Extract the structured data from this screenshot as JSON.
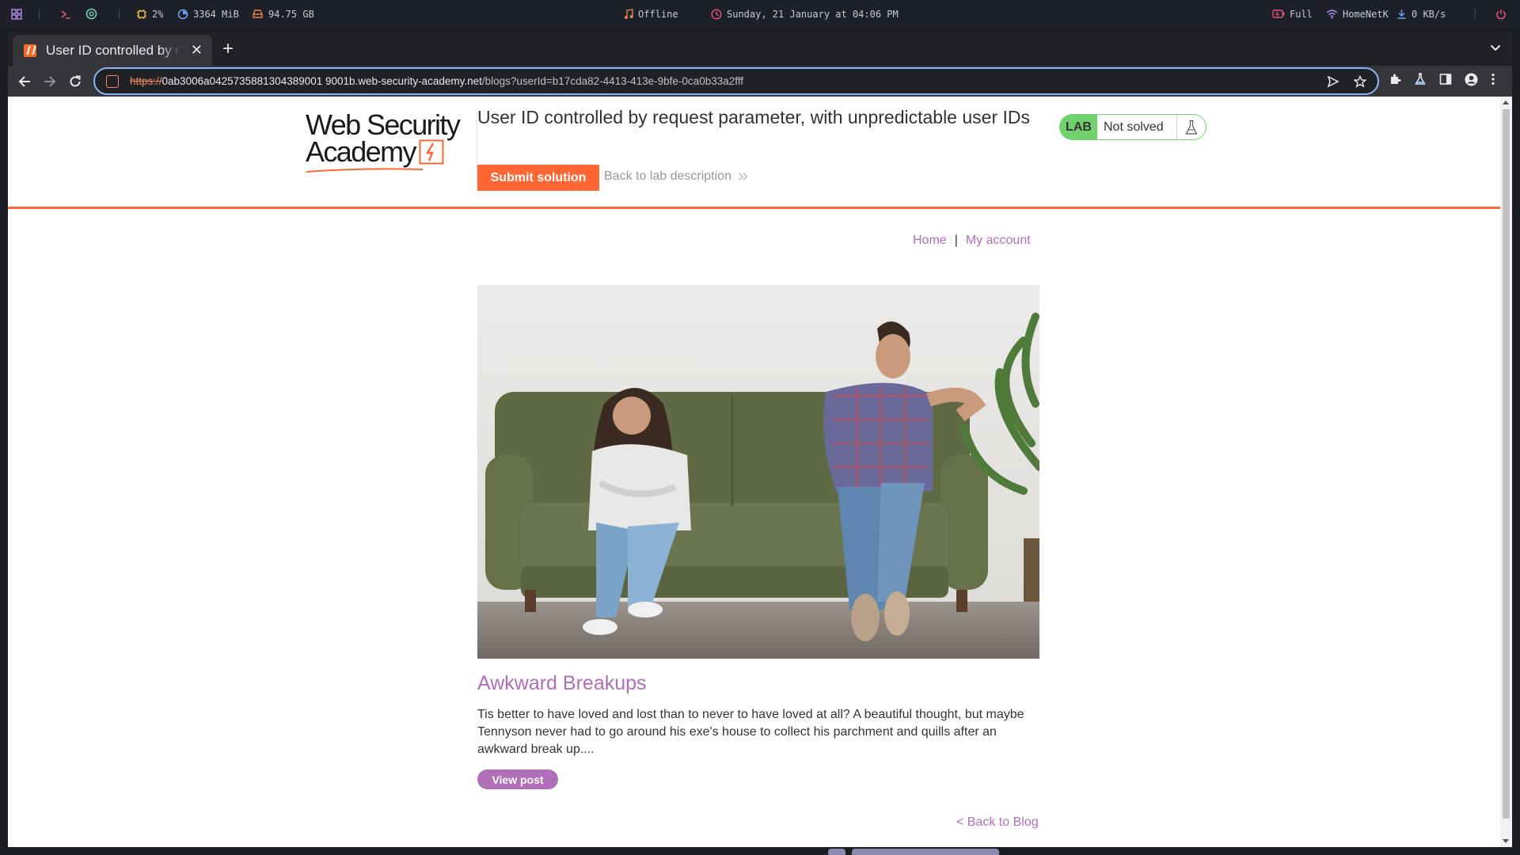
{
  "sysbar": {
    "cpu": "2%",
    "memory": "3364 MiB",
    "disk": "94.75 GB",
    "music": "Offline",
    "datetime": "Sunday, 21 January at 04:06 PM",
    "battery": "Full",
    "wifi": "HomeNetK",
    "net_speed": "0 KB/s"
  },
  "browser": {
    "tab_title": "User ID controlled by request parameter, with unpredictable user IDs",
    "url_scheme": "https://",
    "url_host": "0ab3006a0425735881304389001 9001b.web-security-academy.net",
    "url_path": "/blogs?userId=b17cda82-4413-413e-9bfe-0ca0b33a2fff"
  },
  "lab": {
    "logo_line1": "Web Security",
    "logo_line2": "Academy",
    "title": "User ID controlled by request parameter, with unpredictable user IDs",
    "submit_label": "Submit solution",
    "back_label": "Back to lab description",
    "badge": "LAB",
    "status": "Not solved"
  },
  "nav": {
    "home": "Home",
    "separator": "|",
    "account": "My account"
  },
  "post": {
    "title": "Awkward Breakups",
    "excerpt": "Tis better to have loved and lost than to never to have loved at all? A beautiful thought, but maybe Tennyson never had to go around his exe's house to collect his parchment and quills after an awkward break up....",
    "view_label": "View post",
    "back_label": "< Back to Blog"
  },
  "colors": {
    "accent_orange": "#ff6633",
    "link_purple": "#b06fb8",
    "lab_green": "#70d16d"
  }
}
